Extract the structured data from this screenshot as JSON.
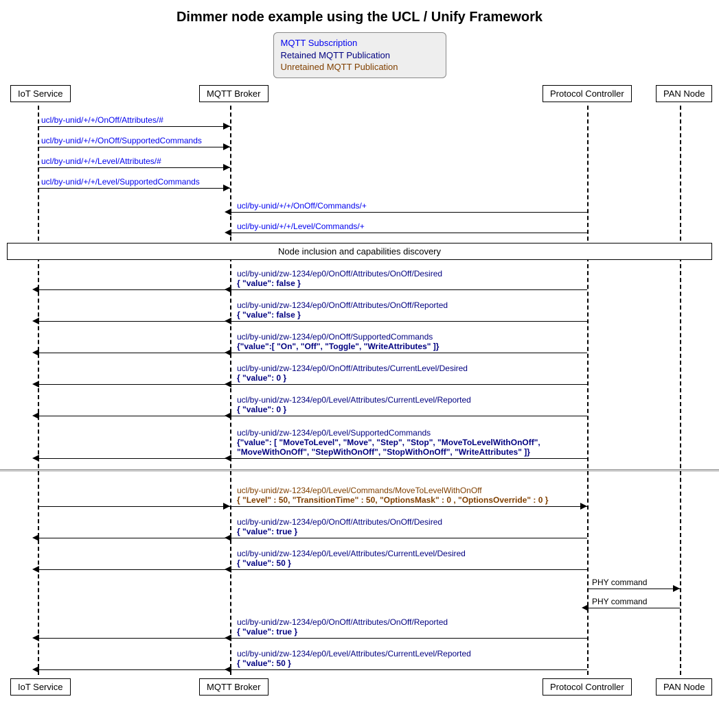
{
  "title": "Dimmer node example using the UCL / Unify Framework",
  "legend": {
    "sub": "MQTT Subscription",
    "ret": "Retained MQTT Publication",
    "unret": "Unretained MQTT Publication"
  },
  "actors": {
    "iot": "IoT Service",
    "broker": "MQTT Broker",
    "pc": "Protocol Controller",
    "pan": "PAN Node"
  },
  "divider": "Node inclusion and capabilities discovery",
  "m": {
    "s1": "ucl/by-unid/+/+/OnOff/Attributes/#",
    "s2": "ucl/by-unid/+/+/OnOff/SupportedCommands",
    "s3": "ucl/by-unid/+/+/Level/Attributes/#",
    "s4": "ucl/by-unid/+/+/Level/SupportedCommands",
    "s5": "ucl/by-unid/+/+/OnOff/Commands/+",
    "s6": "ucl/by-unid/+/+/Level/Commands/+",
    "r1a": "ucl/by-unid/zw-1234/ep0/OnOff/Attributes/OnOff/Desired",
    "r1b": "{ \"value\": false }",
    "r2a": "ucl/by-unid/zw-1234/ep0/OnOff/Attributes/OnOff/Reported",
    "r2b": "{ \"value\": false }",
    "r3a": "ucl/by-unid/zw-1234/ep0/OnOff/SupportedCommands",
    "r3b": "{\"value\":[ \"On\", \"Off\", \"Toggle\", \"WriteAttributes\" ]}",
    "r4a": "ucl/by-unid/zw-1234/ep0/OnOff/Attributes/CurrentLevel/Desired",
    "r4b": "{ \"value\": 0 }",
    "r5a": "ucl/by-unid/zw-1234/ep0/Level/Attributes/CurrentLevel/Reported",
    "r5b": "{ \"value\": 0 }",
    "r6a": "ucl/by-unid/zw-1234/ep0/Level/SupportedCommands",
    "r6b": "{\"value\": [ \"MoveToLevel\", \"Move\", \"Step\", \"Stop\", \"MoveToLevelWithOnOff\",",
    "r6c": "\"MoveWithOnOff\", \"StepWithOnOff\", \"StopWithOnOff\", \"WriteAttributes\" ]}",
    "u1a": "ucl/by-unid/zw-1234/ep0/Level/Commands/MoveToLevelWithOnOff",
    "u1b": "{ \"Level\" : 50, \"TransitionTime\" : 50, \"OptionsMask\" : 0 , \"OptionsOverride\" : 0 }",
    "r7a": "ucl/by-unid/zw-1234/ep0/OnOff/Attributes/OnOff/Desired",
    "r7b": "{ \"value\": true }",
    "r8a": "ucl/by-unid/zw-1234/ep0/Level/Attributes/CurrentLevel/Desired",
    "r8b": "{ \"value\": 50 }",
    "phy": "PHY command",
    "r9a": "ucl/by-unid/zw-1234/ep0/OnOff/Attributes/OnOff/Reported",
    "r9b": "{ \"value\": true }",
    "r10a": "ucl/by-unid/zw-1234/ep0/Level/Attributes/CurrentLevel/Reported",
    "r10b": "{ \"value\": 50 }"
  }
}
